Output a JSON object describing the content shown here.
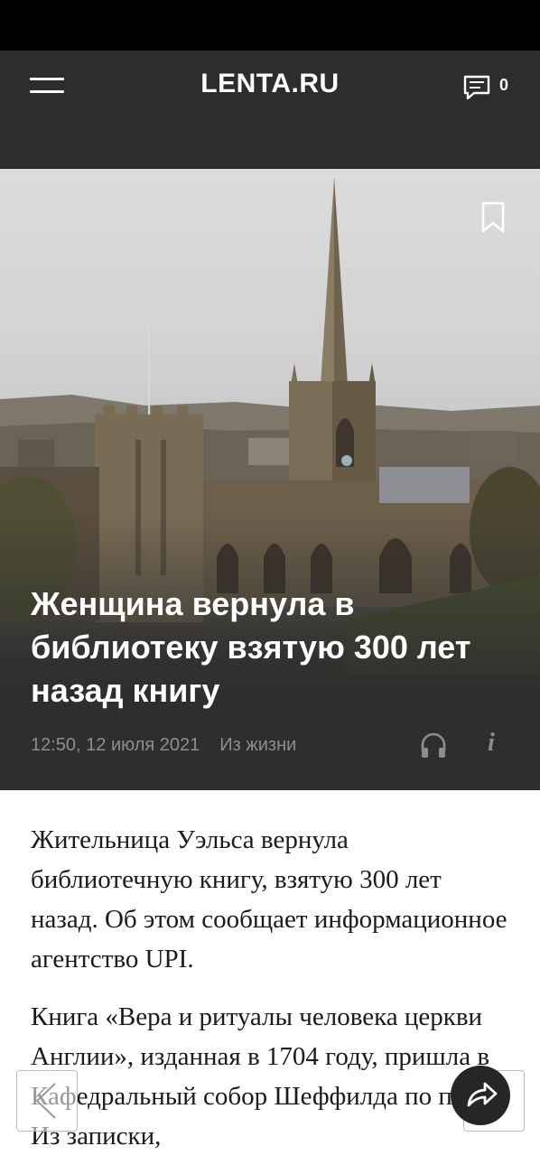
{
  "header": {
    "logo": "LENTA.RU",
    "comment_count": "0"
  },
  "article": {
    "title": "Женщина вернула в библиотеку взятую 300 лет назад книгу",
    "datetime": "12:50, 12 июля 2021",
    "category": "Из жизни",
    "paragraphs": [
      "Жительница Уэльса вернула библиотечную книгу, взятую 300 лет назад. Об этом сообщает информационное агентство UPI.",
      "Книга «Вера и ритуалы человека церкви Англии», изданная в 1704 году, пришла в Кафедральный собор Шеффилда по почте. Из записки,"
    ]
  },
  "icons": {
    "menu": "hamburger-icon",
    "comments": "comment-bubble-icon",
    "bookmark": "bookmark-icon",
    "audio": "headphones-icon",
    "info": "info-icon",
    "prev": "chevron-left-icon",
    "share": "share-arrow-icon"
  },
  "colors": {
    "header_bg": "#2d2d2d",
    "status_bar": "#000000",
    "meta_text": "#8d8d8d",
    "body_text": "#1b1b1b"
  }
}
